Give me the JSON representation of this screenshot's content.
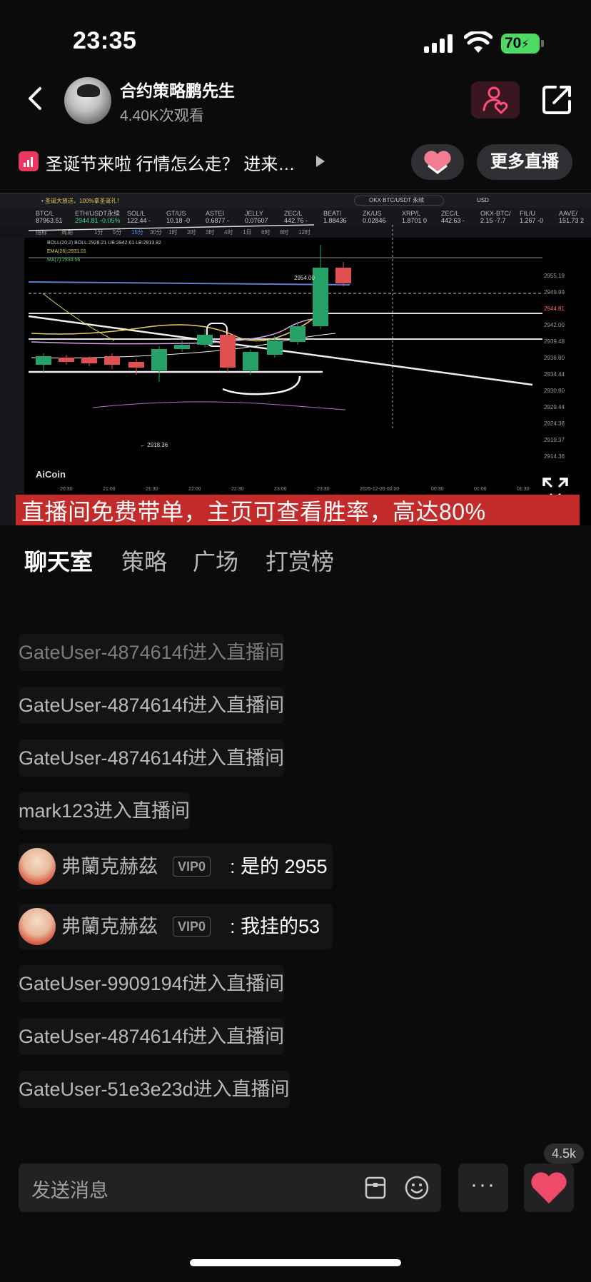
{
  "status": {
    "time": "23:35",
    "battery": "70"
  },
  "header": {
    "host_name": "合约策略鹏先生",
    "views": "4.40K次观看"
  },
  "ticker": {
    "text": "圣诞节来啦 行情怎么走？ 进来…",
    "more_live": "更多直播"
  },
  "video": {
    "caption": "直播间免费带单，主页可查看胜率，高达80%",
    "watermark": "AiCoin",
    "pair": "ETH/USDT永续",
    "pair_price": "2944.81 -0.05%",
    "banner": "• 圣诞大放送，100%拿圣诞礼！",
    "search": "OKX BTC/USDT 永续",
    "currency": "USD",
    "ticker_items": [
      {
        "name": "BTC/L",
        "price": "87963.51"
      },
      {
        "name": "ETH/USDT永续",
        "price": "2944.81 -0.05%"
      },
      {
        "name": "SOL/L",
        "price": "122.44 -"
      },
      {
        "name": "GT/US",
        "price": "10.18 -0"
      },
      {
        "name": "ASTEI",
        "price": "0.6877 -"
      },
      {
        "name": "JELLY",
        "price": "0.07607"
      },
      {
        "name": "ZEC/L",
        "price": "442.76 -"
      },
      {
        "name": "BEAT/",
        "price": "1.88436"
      },
      {
        "name": "ZK/US",
        "price": "0.02846"
      },
      {
        "name": "XRP/L",
        "price": "1.8701 0"
      },
      {
        "name": "ZEC/L",
        "price": "442.63 -"
      },
      {
        "name": "OKX-BTC/",
        "price": "2.15 -7.7"
      },
      {
        "name": "FIL/U",
        "price": "1.267 -0"
      },
      {
        "name": "AAVE/",
        "price": "151.73 2"
      }
    ],
    "toolbar": [
      "指标",
      "周期",
      "1分",
      "5分",
      "15分",
      "30分",
      "1时",
      "2时",
      "3时",
      "4时",
      "1日",
      "6时",
      "8时",
      "12时"
    ],
    "indicators": {
      "boll": "BOLL(20,2)  BOLL:2928.21  UB:2942.61  LB:2913.82",
      "ema": "EMA(26):2931.01",
      "ma": "MA(7):2934.56"
    },
    "price_levels": [
      "2955.19",
      "2949.99",
      "2944.81",
      "2942.00",
      "2939.48",
      "2936.80",
      "2934.44",
      "2930.80",
      "2929.44",
      "2924.38",
      "2919.37",
      "2914.36"
    ],
    "time_labels": [
      "20:30",
      "21:00",
      "21:30",
      "22:00",
      "22:30",
      "23:00",
      "23:30",
      "2025-12-26 00:00",
      "00:30",
      "01:00",
      "01:30"
    ],
    "high_label": "2954.00",
    "low_label": "← 2918.36"
  },
  "tabs": [
    "聊天室",
    "策略",
    "广场",
    "打赏榜"
  ],
  "chat": [
    {
      "type": "sys",
      "text": "GateUser-4874614f进入直播间"
    },
    {
      "type": "sys",
      "text": "GateUser-4874614f进入直播间"
    },
    {
      "type": "sys",
      "text": "GateUser-4874614f进入直播间"
    },
    {
      "type": "sys",
      "text": "mark123进入直播间"
    },
    {
      "type": "user",
      "name": "弗蘭克赫茲",
      "vip": "VIP0",
      "text": ": 是的 2955"
    },
    {
      "type": "user",
      "name": "弗蘭克赫茲",
      "vip": "VIP0",
      "text": ": 我挂的53"
    },
    {
      "type": "sys",
      "text": "GateUser-9909194f进入直播间"
    },
    {
      "type": "sys",
      "text": "GateUser-4874614f进入直播间"
    },
    {
      "type": "sys",
      "text": "GateUser-51e3e23d进入直播间"
    }
  ],
  "bottom": {
    "placeholder": "发送消息",
    "more": "···",
    "like_count": "4.5k"
  },
  "colors": {
    "accent_red": "#c32a2a",
    "battery_green": "#4cd964",
    "candle_up": "#26a269",
    "candle_down": "#e05050"
  }
}
